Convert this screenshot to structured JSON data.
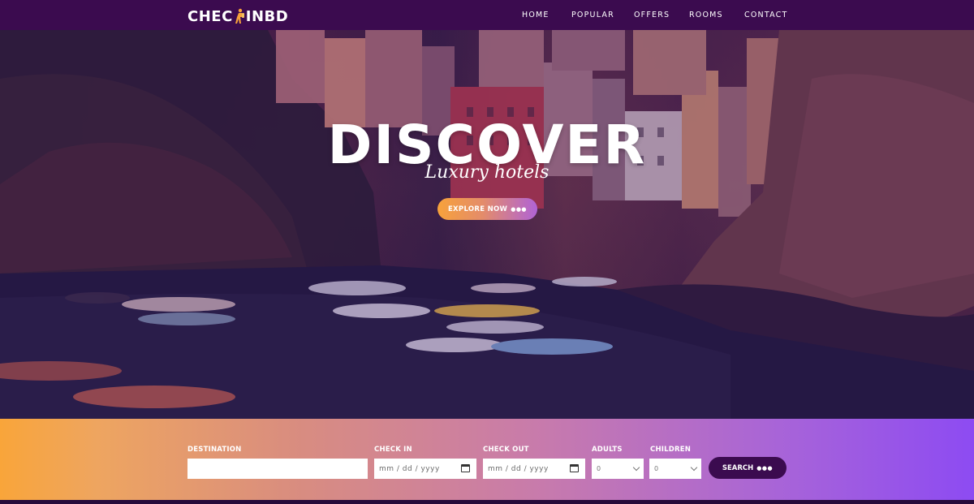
{
  "brand": {
    "logo_text_left": "CHEC",
    "logo_text_right": "INBD"
  },
  "nav": {
    "items": [
      {
        "label": "HOME"
      },
      {
        "label": "POPULAR"
      },
      {
        "label": "OFFERS"
      },
      {
        "label": "ROOMS"
      },
      {
        "label": "CONTACT"
      }
    ]
  },
  "hero": {
    "title": "DISCOVER",
    "subtitle": "Luxury hotels",
    "cta_label": "EXPLORE NOW",
    "cta_dots": "●●●"
  },
  "search": {
    "destination": {
      "label": "DESTINATION",
      "value": ""
    },
    "check_in": {
      "label": "CHECK IN",
      "placeholder": "mm / dd / yyyy"
    },
    "check_out": {
      "label": "CHECK OUT",
      "placeholder": "mm / dd / yyyy"
    },
    "adults": {
      "label": "ADULTS",
      "selected": "0"
    },
    "children": {
      "label": "CHILDREN",
      "selected": "0"
    },
    "button_label": "SEARCH",
    "button_dots": "●●●"
  },
  "colors": {
    "nav_bg": "#3b0b4f",
    "accent_orange": "#f7a23b",
    "accent_purple": "#8d4bf2",
    "search_button": "#3b0b4f"
  },
  "icons": {
    "logo_figure": "traveler-icon",
    "calendar": "calendar-icon",
    "dropdown": "chevron-down-icon"
  }
}
